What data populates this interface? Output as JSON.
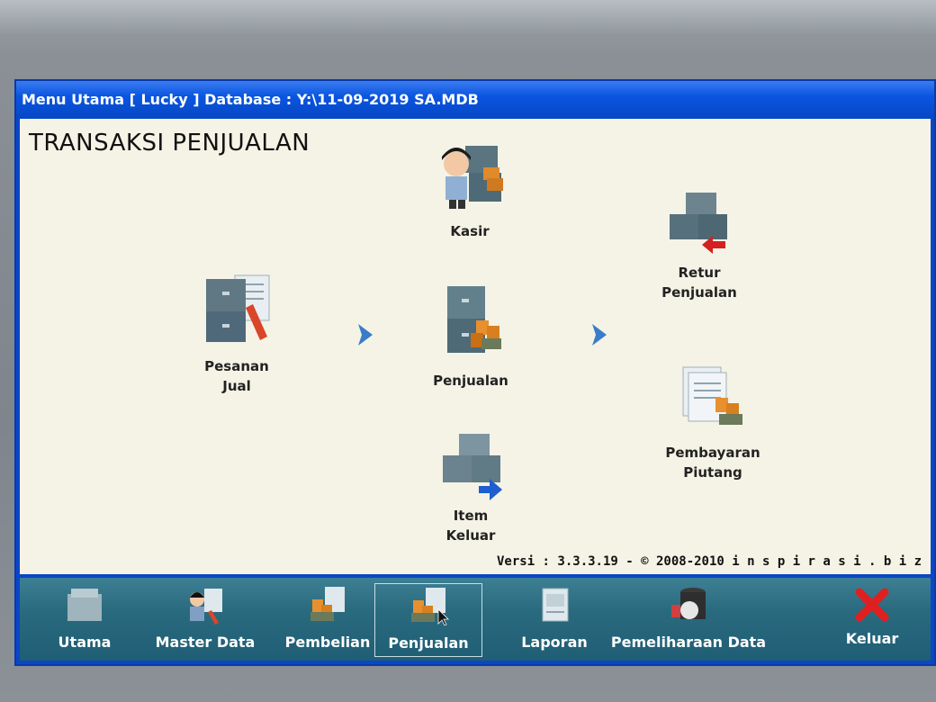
{
  "window": {
    "title": "Menu Utama [ Lucky ] Database : Y:\\11-09-2019 SA.MDB"
  },
  "page": {
    "title": "TRANSAKSI PENJUALAN",
    "version": "Versi : 3.3.3.19 -  ©  2008-2010  i n s p i r a s i . b i z"
  },
  "items": {
    "kasir": "Kasir",
    "pesanan_line1": "Pesanan",
    "pesanan_line2": "Jual",
    "penjualan": "Penjualan",
    "retur_line1": "Retur",
    "retur_line2": "Penjualan",
    "pembayaran_line1": "Pembayaran",
    "pembayaran_line2": "Piutang",
    "item_keluar_line1": "Item",
    "item_keluar_line2": "Keluar"
  },
  "taskbar": {
    "utama": "Utama",
    "master_data": "Master Data",
    "pembelian": "Pembelian",
    "penjualan": "Penjualan",
    "laporan": "Laporan",
    "pemeliharaan": "Pemeliharaan Data",
    "keluar": "Keluar"
  },
  "colors": {
    "title_bar": "#0a55e0",
    "content_bg": "#f4f3e6",
    "taskbar": "#2a6a7f",
    "keluar_x": "#e02020",
    "arrow": "#3a7cc8"
  }
}
